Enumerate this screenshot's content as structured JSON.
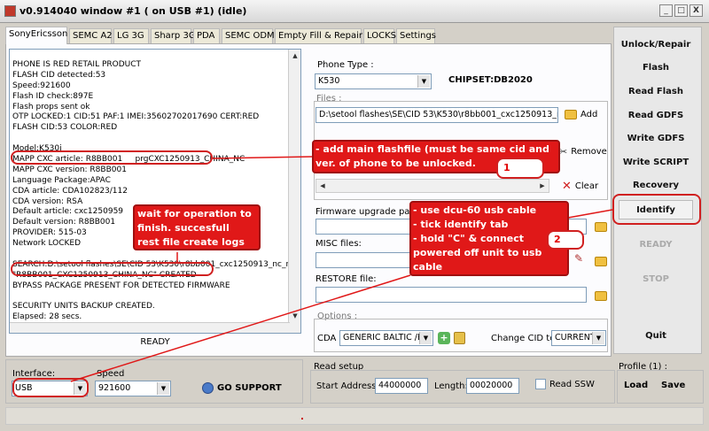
{
  "window": {
    "title": "v0.914040 window #1 ( on USB #1) (idle)",
    "controls": [
      "_",
      "□",
      "X"
    ]
  },
  "tabs": [
    "SonyEricsson",
    "SEMC A2",
    "LG 3G",
    "Sharp 3G",
    "PDA",
    "SEMC ODM",
    "Empty Fill & Repair",
    "LOCKS",
    "Settings"
  ],
  "log": {
    "lines": [
      "PHONE IS RED RETAIL PRODUCT",
      "FLASH CID detected:53",
      "Speed:921600",
      "Flash ID check:897E",
      "Flash props sent ok",
      "OTP LOCKED:1 CID:51 PAF:1 IMEI:35602702017690 CERT:RED",
      "FLASH CID:53 COLOR:RED",
      "",
      "Model:K530i",
      "MAPP CXC article: R8BB001     prgCXC1250913_CHINA_NC",
      "MAPP CXC version: R8BB001",
      "Language Package:APAC",
      "CDA article: CDA102823/112",
      "CDA version: RSA",
      "Default article: cxc1250959",
      "Default version: R8BB001",
      "PROVIDER: 515-03",
      "Network LOCKED",
      "",
      "SEARCH:D:\\setool flashes\\SE\\CID 53\\K530\\r8bb001_cxc1250913_nc_re",
      "\"R8BB001_CXC1250913_CHINA_NC\" CREATED",
      "BYPASS PACKAGE PRESENT FOR DETECTED FIRMWARE",
      "",
      "SECURITY UNITS BACKUP CREATED.",
      "Elapsed: 28 secs."
    ],
    "status": "READY"
  },
  "phone_type": {
    "label": "Phone Type :",
    "value": "K530",
    "chipset": "CHIPSET:DB2020"
  },
  "files": {
    "label": "Files :",
    "path": "D:\\setool flashes\\SE\\CID 53\\K530\\r8bb001_cxc1250913_nc_",
    "add": "Add",
    "remove": "Remove",
    "clear": "Clear"
  },
  "firmware_label": "Firmware upgrade pack:",
  "misc_label": "MISC files:",
  "restore_label": "RESTORE file:",
  "options": {
    "label": "Options :",
    "cda_label": "CDA",
    "cda_value": "GENERIC BALTIC  /E",
    "change_cid_label": "Change CID to",
    "change_cid_value": "CURRENT"
  },
  "interface": {
    "label": "Interface:",
    "value": "USB",
    "speed_label": "Speed",
    "speed_value": "921600",
    "go_support": "GO SUPPORT"
  },
  "read_setup": {
    "label": "Read setup",
    "start_label": "Start Address:",
    "start_value": "44000000",
    "length_label": "Length:",
    "length_value": "00020000",
    "read_ssw": "Read SSW"
  },
  "profile": {
    "label": "Profile (1) :",
    "load": "Load",
    "save": "Save"
  },
  "right_buttons": [
    "Unlock/Repair",
    "Flash",
    "Read Flash",
    "Read GDFS",
    "Write GDFS",
    "Write SCRIPT",
    "Recovery",
    "Identify",
    "READY",
    "STOP",
    "Quit"
  ],
  "annotations": {
    "note1": [
      "- add main flashfile (must be same cid and",
      "ver. of phone to be unlocked."
    ],
    "note1_num": "1",
    "note2": [
      "- use dcu-60 usb cable",
      "- tick identify tab",
      "- hold \"C\" & connect",
      "powered off unit to usb",
      "cable"
    ],
    "note2_num": "2",
    "note3": [
      "wait for operation to",
      "finish. succesfull",
      "rest file create logs"
    ],
    "accent": "#e01818"
  }
}
